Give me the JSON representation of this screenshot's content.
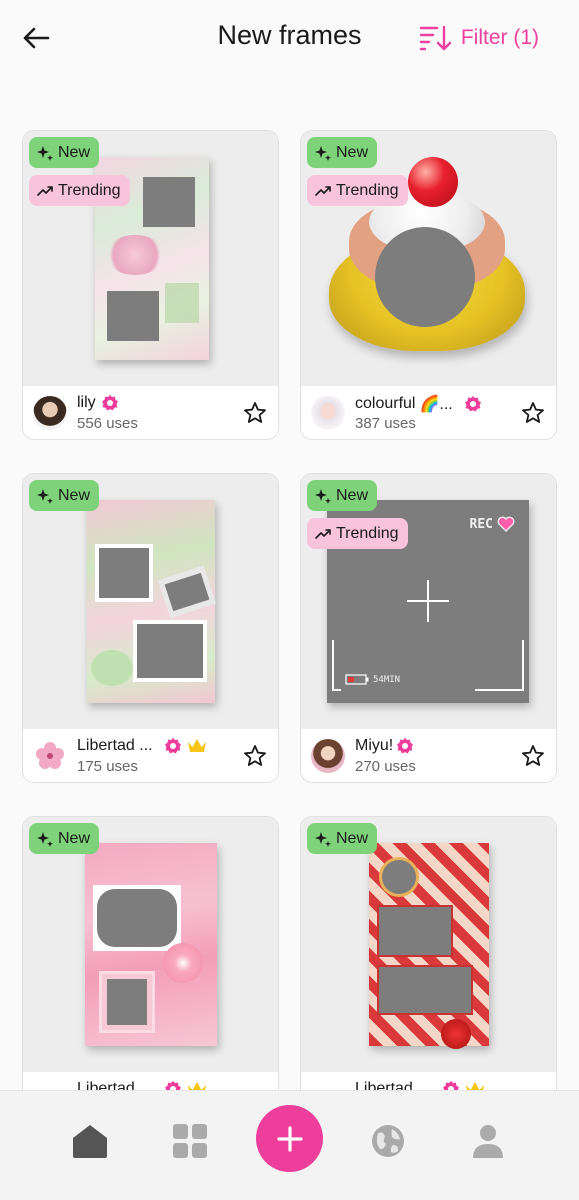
{
  "header": {
    "title": "New frames",
    "filter_label": "Filter (1)"
  },
  "badges": {
    "new": "New",
    "trending": "Trending"
  },
  "cards": [
    {
      "author": "lily",
      "uses": "556 uses"
    },
    {
      "author": "colourful",
      "emoji": "🌈...",
      "uses": "387 uses"
    },
    {
      "author": "Libertad ...",
      "uses": "175 uses"
    },
    {
      "author": "Miyu!",
      "uses": "270 uses"
    },
    {
      "author": "Libertad ...",
      "uses": ""
    },
    {
      "author": "Libertad ...",
      "uses": ""
    }
  ],
  "frame_text": {
    "rec": "REC",
    "battery": "54MIN"
  },
  "colors": {
    "accent": "#ee3e9b",
    "new_badge": "#7ed37a",
    "trending_badge": "#f7c4dc",
    "verified": "#ee3e9b",
    "crown": "#f5c518"
  },
  "nav": {
    "items": [
      "home-icon",
      "grid-icon",
      "add-icon",
      "globe-icon",
      "profile-icon"
    ]
  }
}
